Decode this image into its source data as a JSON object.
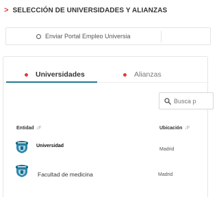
{
  "header": {
    "title": "SELECCIÓN DE UNIVERSIDADES Y ALIANZAS",
    "icon": "chevron-right-icon",
    "accent_color": "#e23a3a"
  },
  "actions": {
    "portal_label": "Enviar Portal Empleo Universia",
    "portal_icon": "radio-icon"
  },
  "tabs": [
    {
      "label": "Universidades",
      "active": true
    },
    {
      "label": "Alianzas",
      "active": false
    }
  ],
  "active_tab_color": "#1f7a8c",
  "search": {
    "placeholder": "Busca p",
    "icon": "search-icon"
  },
  "table": {
    "columns": [
      {
        "label": "Entidad",
        "sort_icon": "sort-icon"
      },
      {
        "label": "Ubicación",
        "sort_icon": "sort-icon"
      }
    ],
    "rows": [
      {
        "entity": "Universidad",
        "location": "Madrid",
        "logo": "university-crest-icon"
      },
      {
        "entity": "Facultad de medicina",
        "location": "Madrid",
        "logo": "university-crest-icon"
      }
    ]
  }
}
